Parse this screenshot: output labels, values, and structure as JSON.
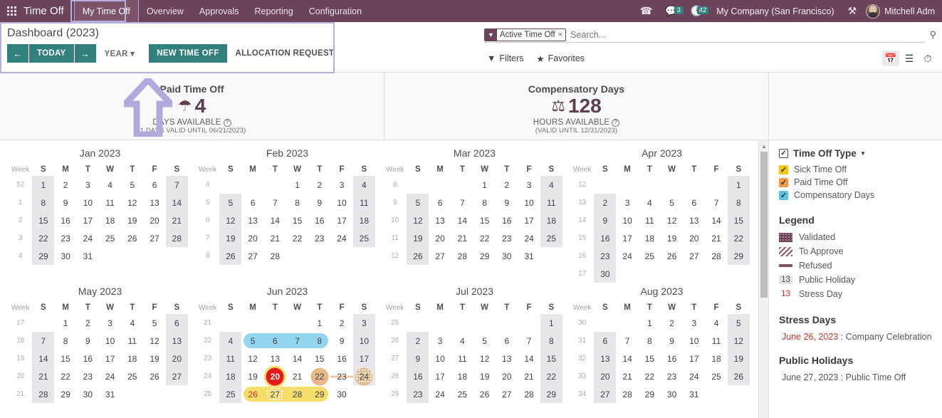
{
  "appbar": {
    "app_name": "Time Off",
    "menus": [
      "My Time Off",
      "Overview",
      "Approvals",
      "Reporting",
      "Configuration"
    ],
    "active_menu": "My Time Off",
    "chat_badge": "3",
    "activity_badge": "42",
    "company": "My Company (San Francisco)",
    "username": "Mitchell Adm"
  },
  "control_panel": {
    "breadcrumb": "Dashboard (2023)",
    "prev_label": "←",
    "today_label": "TODAY",
    "next_label": "→",
    "scale_label": "YEAR",
    "new_time_off_label": "NEW TIME OFF",
    "allocation_request_label": "ALLOCATION REQUEST"
  },
  "search": {
    "facet_label": "Active Time Off",
    "facet_remove": "×",
    "placeholder": "Search...",
    "filters_label": "Filters",
    "favorites_label": "Favorites",
    "views": [
      "calendar-view-icon",
      "list-view-icon",
      "activity-view-icon"
    ]
  },
  "stats": [
    {
      "title": "Paid Time Off",
      "icon": "umbrella-icon",
      "value": "4",
      "unit": "DAYS AVAILABLE",
      "note": "(1 DAYS VALID UNTIL 06/21/2023)"
    },
    {
      "title": "Compensatory Days",
      "icon": "scales-icon",
      "value": "128",
      "unit": "HOURS AVAILABLE",
      "note": "(VALID UNTIL 12/31/2023)"
    }
  ],
  "calendar": {
    "weekday_headers": [
      "S",
      "M",
      "T",
      "W",
      "T",
      "F",
      "S"
    ],
    "week_header": "Week",
    "months": [
      {
        "title": "Jan 2023",
        "weeks": [
          {
            "num": "52",
            "days": [
              "1",
              "2",
              "3",
              "4",
              "5",
              "6",
              "7"
            ]
          },
          {
            "num": "1",
            "days": [
              "8",
              "9",
              "10",
              "11",
              "12",
              "13",
              "14"
            ]
          },
          {
            "num": "2",
            "days": [
              "15",
              "16",
              "17",
              "18",
              "19",
              "20",
              "21"
            ]
          },
          {
            "num": "3",
            "days": [
              "22",
              "23",
              "24",
              "25",
              "26",
              "27",
              "28"
            ]
          },
          {
            "num": "4",
            "days": [
              "29",
              "30",
              "31",
              "",
              "",
              "",
              ""
            ]
          }
        ]
      },
      {
        "title": "Feb 2023",
        "weeks": [
          {
            "num": "4",
            "days": [
              "",
              "",
              "",
              "1",
              "2",
              "3",
              "4"
            ]
          },
          {
            "num": "5",
            "days": [
              "5",
              "6",
              "7",
              "8",
              "9",
              "10",
              "11"
            ]
          },
          {
            "num": "6",
            "days": [
              "12",
              "13",
              "14",
              "15",
              "16",
              "17",
              "18"
            ]
          },
          {
            "num": "7",
            "days": [
              "19",
              "20",
              "21",
              "22",
              "23",
              "24",
              "25"
            ]
          },
          {
            "num": "8",
            "days": [
              "26",
              "27",
              "28",
              "",
              "",
              "",
              ""
            ]
          }
        ]
      },
      {
        "title": "Mar 2023",
        "weeks": [
          {
            "num": "8",
            "days": [
              "",
              "",
              "",
              "1",
              "2",
              "3",
              "4"
            ]
          },
          {
            "num": "9",
            "days": [
              "5",
              "6",
              "7",
              "8",
              "9",
              "10",
              "11"
            ]
          },
          {
            "num": "10",
            "days": [
              "12",
              "13",
              "14",
              "15",
              "16",
              "17",
              "18"
            ]
          },
          {
            "num": "11",
            "days": [
              "19",
              "20",
              "21",
              "22",
              "23",
              "24",
              "25"
            ]
          },
          {
            "num": "12",
            "days": [
              "26",
              "27",
              "28",
              "29",
              "30",
              "31",
              ""
            ]
          }
        ]
      },
      {
        "title": "Apr 2023",
        "weeks": [
          {
            "num": "12",
            "days": [
              "",
              "",
              "",
              "",
              "",
              "",
              "1"
            ]
          },
          {
            "num": "13",
            "days": [
              "2",
              "3",
              "4",
              "5",
              "6",
              "7",
              "8"
            ]
          },
          {
            "num": "14",
            "days": [
              "9",
              "10",
              "11",
              "12",
              "13",
              "14",
              "15"
            ]
          },
          {
            "num": "15",
            "days": [
              "16",
              "17",
              "18",
              "19",
              "20",
              "21",
              "22"
            ]
          },
          {
            "num": "16",
            "days": [
              "23",
              "24",
              "25",
              "26",
              "27",
              "28",
              "29"
            ]
          },
          {
            "num": "17",
            "days": [
              "30",
              "",
              "",
              "",
              "",
              "",
              ""
            ]
          }
        ]
      },
      {
        "title": "May 2023",
        "weeks": [
          {
            "num": "17",
            "days": [
              "",
              "1",
              "2",
              "3",
              "4",
              "5",
              "6"
            ]
          },
          {
            "num": "18",
            "days": [
              "7",
              "8",
              "9",
              "10",
              "11",
              "12",
              "13"
            ]
          },
          {
            "num": "19",
            "days": [
              "14",
              "15",
              "16",
              "17",
              "18",
              "19",
              "20"
            ]
          },
          {
            "num": "20",
            "days": [
              "21",
              "22",
              "23",
              "24",
              "25",
              "26",
              "27"
            ]
          },
          {
            "num": "21",
            "days": [
              "28",
              "29",
              "30",
              "31",
              "",
              "",
              ""
            ]
          }
        ]
      },
      {
        "title": "Jun 2023",
        "weeks": [
          {
            "num": "21",
            "days": [
              "",
              "",
              "",
              "",
              "1",
              "2",
              "3"
            ]
          },
          {
            "num": "22",
            "days": [
              "4",
              "5",
              "6",
              "7",
              "8",
              "9",
              "10"
            ]
          },
          {
            "num": "23",
            "days": [
              "11",
              "12",
              "13",
              "14",
              "15",
              "16",
              "17"
            ]
          },
          {
            "num": "24",
            "days": [
              "18",
              "19",
              "20",
              "21",
              "22",
              "23",
              "24"
            ]
          },
          {
            "num": "25",
            "days": [
              "25",
              "26",
              "27",
              "28",
              "29",
              "30",
              ""
            ]
          }
        ]
      },
      {
        "title": "Jul 2023",
        "weeks": [
          {
            "num": "25",
            "days": [
              "",
              "",
              "",
              "",
              "",
              "",
              "1"
            ]
          },
          {
            "num": "26",
            "days": [
              "2",
              "3",
              "4",
              "5",
              "6",
              "7",
              "8"
            ]
          },
          {
            "num": "27",
            "days": [
              "9",
              "10",
              "11",
              "12",
              "13",
              "14",
              "15"
            ]
          },
          {
            "num": "28",
            "days": [
              "16",
              "17",
              "18",
              "19",
              "20",
              "21",
              "22"
            ]
          },
          {
            "num": "29",
            "days": [
              "23",
              "24",
              "25",
              "26",
              "27",
              "28",
              "29"
            ]
          }
        ]
      },
      {
        "title": "Aug 2023",
        "weeks": [
          {
            "num": "30",
            "days": [
              "",
              "",
              "1",
              "2",
              "3",
              "4",
              "5"
            ]
          },
          {
            "num": "31",
            "days": [
              "6",
              "7",
              "8",
              "9",
              "10",
              "11",
              "12"
            ]
          },
          {
            "num": "32",
            "days": [
              "13",
              "14",
              "15",
              "16",
              "17",
              "18",
              "19"
            ]
          },
          {
            "num": "33",
            "days": [
              "20",
              "21",
              "22",
              "23",
              "24",
              "25",
              "26"
            ]
          },
          {
            "num": "34",
            "days": [
              "27",
              "28",
              "29",
              "30",
              "31",
              "",
              ""
            ]
          }
        ]
      }
    ],
    "highlights": {
      "jun_compensatory": {
        "range": "June 5 - June 8",
        "color": "#93d5ef",
        "type": "Compensatory Days"
      },
      "jun_today": {
        "day": "20",
        "color": "#e51b1b",
        "type": "today"
      },
      "jun_paid": {
        "range": "June 22 - June 24",
        "color": "#eec9a3",
        "type": "Paid Time Off"
      },
      "jun_sick": {
        "range": "June 26 - June 29",
        "color": "#f7dd6a",
        "type": "Sick Time Off"
      }
    }
  },
  "sidebar": {
    "filter_title": "Time Off Type",
    "types": [
      {
        "label": "Sick Time Off",
        "color": "#f5c518",
        "checked": true
      },
      {
        "label": "Paid Time Off",
        "color": "#f09a4e",
        "checked": true
      },
      {
        "label": "Compensatory Days",
        "color": "#5bc3e8",
        "checked": true
      }
    ],
    "legend_title": "Legend",
    "legend": [
      {
        "label": "Validated",
        "swatch": "validated-swatch"
      },
      {
        "label": "To Approve",
        "swatch": "to-approve-swatch"
      },
      {
        "label": "Refused",
        "swatch": "refused-swatch"
      },
      {
        "label": "Public Holiday",
        "swatch": "13"
      },
      {
        "label": "Stress Day",
        "swatch": "13"
      }
    ],
    "stress_days_title": "Stress Days",
    "stress_days": [
      {
        "date": "June 26, 2023",
        "sep": " : ",
        "name": "Company Celebration"
      }
    ],
    "public_holidays_title": "Public Holidays",
    "public_holidays": [
      {
        "date": "June 27, 2023",
        "sep": " : ",
        "name": "Public Time Off"
      }
    ]
  }
}
